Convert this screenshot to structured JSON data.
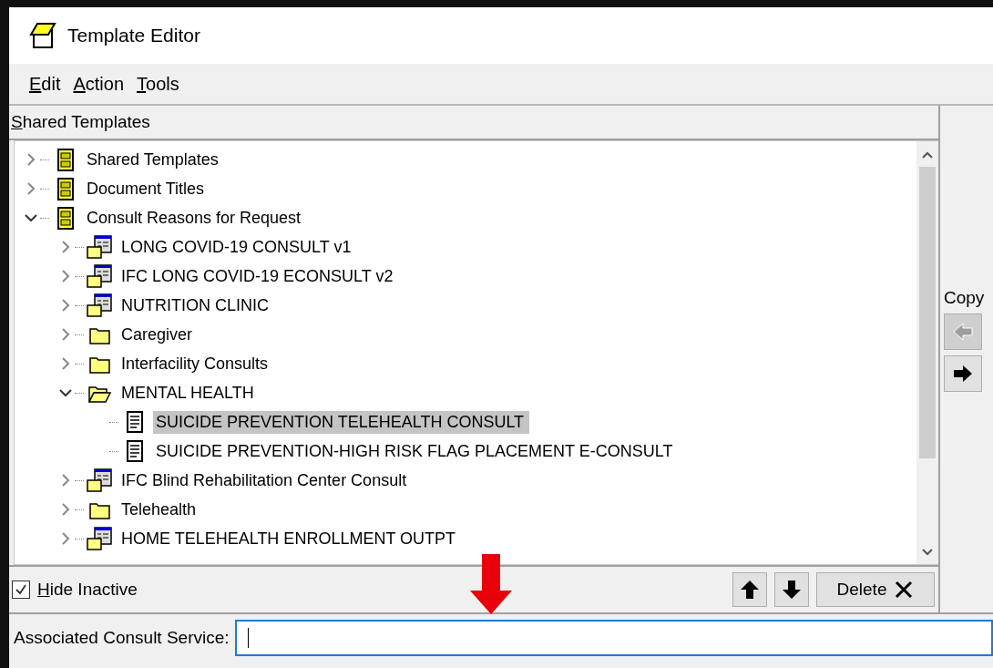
{
  "window": {
    "title": "Template Editor"
  },
  "menu": [
    {
      "label": "Edit"
    },
    {
      "label": "Action"
    },
    {
      "label": "Tools"
    }
  ],
  "panel": {
    "label": "Shared Templates"
  },
  "tree": [
    {
      "label": "Shared Templates",
      "kind": "cabinet",
      "expanded": false,
      "selected": false
    },
    {
      "label": "Document Titles",
      "kind": "cabinet",
      "expanded": false,
      "selected": false
    },
    {
      "label": "Consult Reasons for Request",
      "kind": "cabinet",
      "expanded": true,
      "selected": false,
      "children": [
        {
          "label": "LONG COVID-19 CONSULT  v1",
          "kind": "dialog",
          "expanded": false,
          "selected": false
        },
        {
          "label": "IFC LONG COVID-19 ECONSULT  v2",
          "kind": "dialog",
          "expanded": false,
          "selected": false
        },
        {
          "label": "NUTRITION CLINIC",
          "kind": "dialog",
          "expanded": false,
          "selected": false
        },
        {
          "label": "Caregiver",
          "kind": "folder",
          "expanded": false,
          "selected": false
        },
        {
          "label": "Interfacility Consults",
          "kind": "folder",
          "expanded": false,
          "selected": false
        },
        {
          "label": "MENTAL HEALTH",
          "kind": "folder",
          "expanded": true,
          "selected": false,
          "children": [
            {
              "label": "SUICIDE PREVENTION TELEHEALTH CONSULT",
              "kind": "document",
              "selected": true
            },
            {
              "label": "SUICIDE PREVENTION-HIGH RISK FLAG PLACEMENT E-CONSULT",
              "kind": "document",
              "selected": false
            }
          ]
        },
        {
          "label": "IFC Blind Rehabilitation Center Consult",
          "kind": "dialog",
          "expanded": false,
          "selected": false
        },
        {
          "label": "Telehealth",
          "kind": "folder",
          "expanded": false,
          "selected": false
        },
        {
          "label": "HOME TELEHEALTH ENROLLMENT OUTPT",
          "kind": "dialog",
          "expanded": false,
          "selected": false
        }
      ]
    }
  ],
  "copy": {
    "label": "Copy",
    "left_disabled": true,
    "right_disabled": false
  },
  "hide_inactive": {
    "label": "Hide Inactive",
    "checked": true
  },
  "delete_button": "Delete",
  "consult_service": {
    "label": "Associated Consult Service:"
  }
}
